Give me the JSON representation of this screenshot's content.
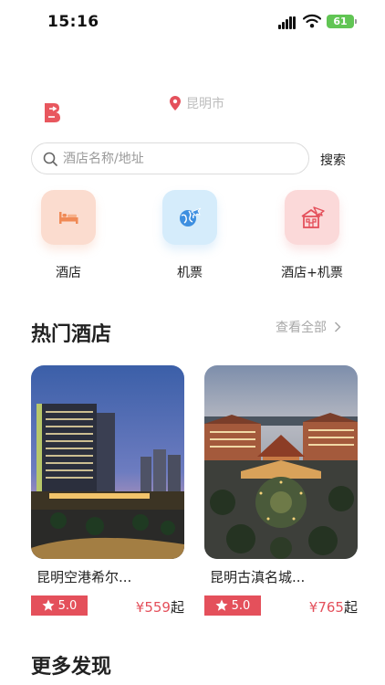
{
  "status_bar": {
    "time": "15:16",
    "battery": "61"
  },
  "header": {
    "city": "昆明市"
  },
  "search": {
    "placeholder": "酒店名称/地址",
    "button_label": "搜索"
  },
  "categories": [
    {
      "label": "酒店",
      "icon": "bed-icon"
    },
    {
      "label": "机票",
      "icon": "globe-plane-icon"
    },
    {
      "label": "酒店+机票",
      "icon": "hotel-plane-icon"
    }
  ],
  "hot_hotels": {
    "title": "热门酒店",
    "view_all": "查看全部",
    "items": [
      {
        "name": "昆明空港希尔...",
        "rating": "5.0",
        "price": "¥559",
        "price_unit": "起"
      },
      {
        "name": "昆明古滇名城...",
        "rating": "5.0",
        "price": "¥765",
        "price_unit": "起"
      }
    ]
  },
  "more": {
    "title": "更多发现"
  },
  "colors": {
    "accent": "#e4505b",
    "hotel_tile": "#fbdccf",
    "flight_tile": "#d5ecfb",
    "combo_tile": "#fbd9d9"
  }
}
